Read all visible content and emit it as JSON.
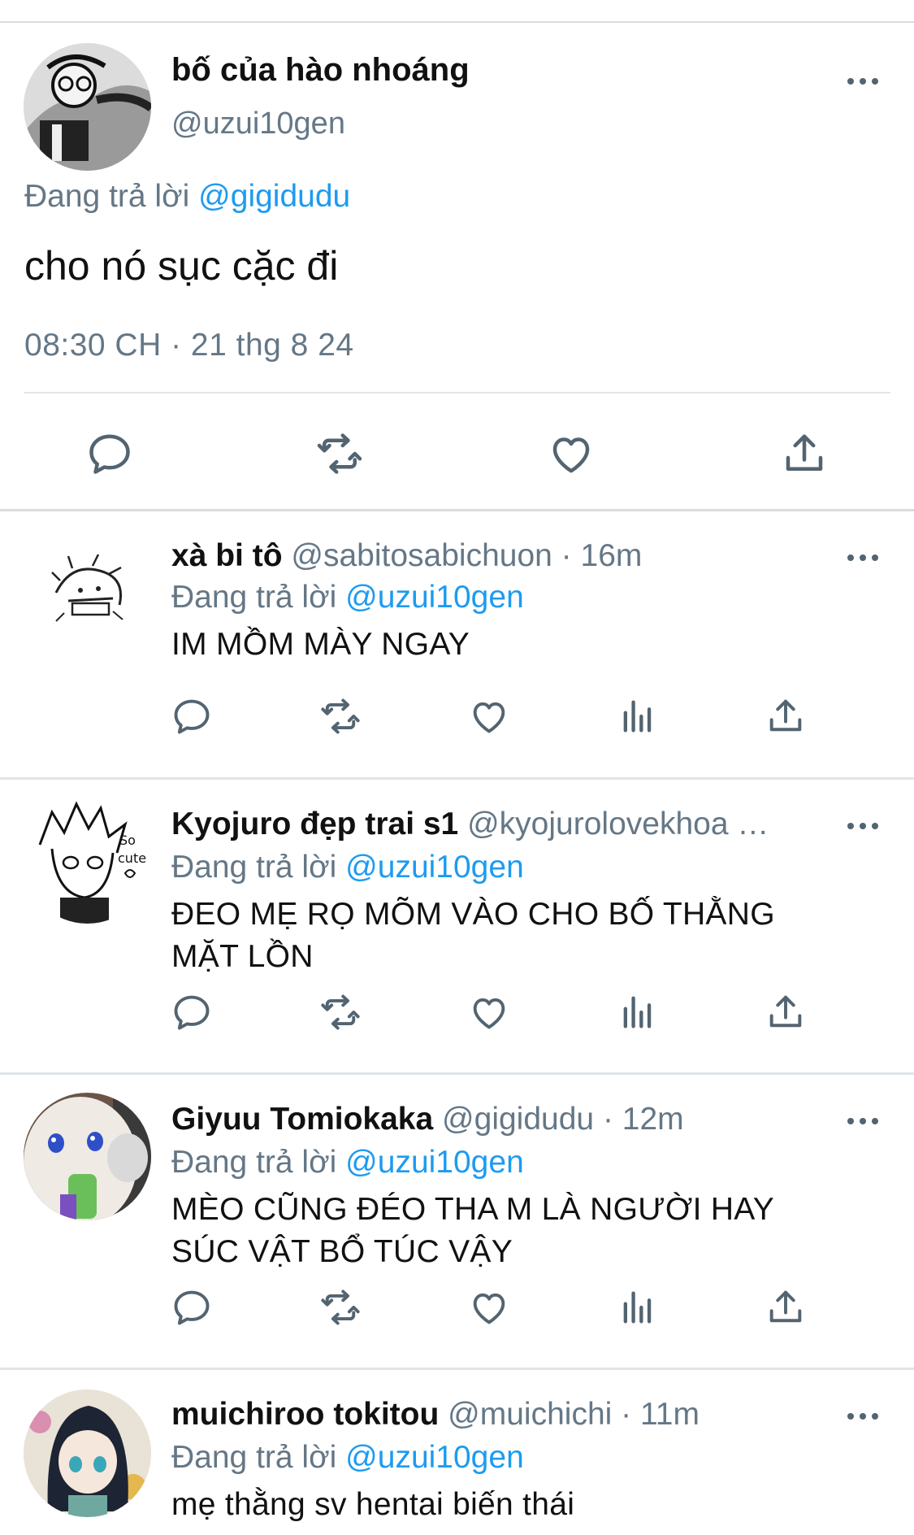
{
  "main_tweet": {
    "display_name": "bố của hào nhoáng",
    "handle": "@uzui10gen",
    "replying_prefix": "Đang trả lời",
    "replying_to": "@gigidudu",
    "text": "cho nó sục cặc đi",
    "meta": "08:30 CH · 21 thg 8 24",
    "actions": [
      "reply-icon",
      "retweet-icon",
      "like-icon",
      "share-icon"
    ]
  },
  "replies": [
    {
      "display_name": "xà bi tô",
      "handle": "@sabitosabichuon · 16m",
      "replying_prefix": "Đang trả lời",
      "replying_to": "@uzui10gen",
      "text": "IM MỒM MÀY NGAY"
    },
    {
      "display_name": "Kyojuro đẹp trai s1",
      "handle": "@kyojurolovekhoa …",
      "replying_prefix": "Đang trả lời",
      "replying_to": "@uzui10gen",
      "text": "ĐEO MẸ RỌ MÕM VÀO CHO BỐ THẰNG MẶT LỒN"
    },
    {
      "display_name": "Giyuu Tomiokaka",
      "handle": "@gigidudu · 12m",
      "replying_prefix": "Đang trả lời",
      "replying_to": "@uzui10gen",
      "text": "MÈO CŨNG ĐÉO THA M LÀ NGƯỜI HAY SÚC VẬT BỔ TÚC VẬY"
    },
    {
      "display_name": "muichiroo tokitou",
      "handle": "@muichichi · 11m",
      "replying_prefix": "Đang trả lời",
      "replying_to": "@uzui10gen",
      "text": "mẹ thằng sv hentai biến thái"
    }
  ],
  "reply_actions": [
    "reply-icon",
    "retweet-icon",
    "like-icon",
    "views-icon",
    "share-icon"
  ],
  "colors": {
    "text": "#111111",
    "secondary": "#657786",
    "accent": "#1d9bf0",
    "divider": "#e1e5e8"
  }
}
